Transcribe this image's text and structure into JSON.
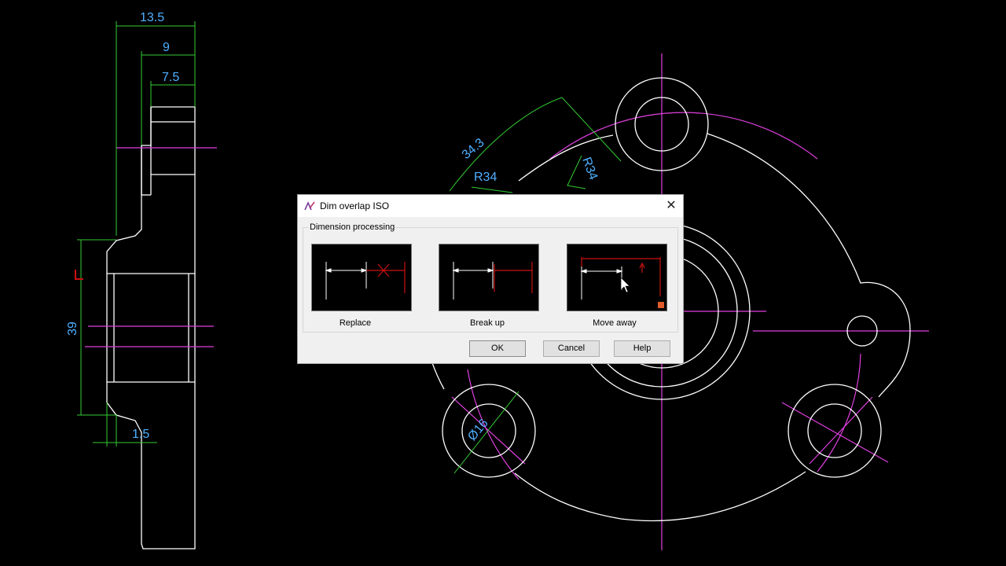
{
  "drawing": {
    "dimensions": {
      "width_overall": "13.5",
      "width_mid": "9",
      "width_inner": "7.5",
      "height_bore": "39",
      "step": "1.5",
      "arc_length": "34.3",
      "radius_left": "R34",
      "radius_right": "R34",
      "hole_diameter": "Ø16"
    }
  },
  "dialog": {
    "title": "Dim overlap ISO",
    "close_glyph": "✕",
    "group_label": "Dimension processing",
    "options": [
      {
        "label": "Replace"
      },
      {
        "label": "Break up"
      },
      {
        "label": "Move away"
      }
    ],
    "buttons": {
      "ok": "OK",
      "cancel": "Cancel",
      "help": "Help"
    }
  },
  "colors": {
    "background": "#000000",
    "geometry": "#ffffff",
    "centerline": "#e040e0",
    "dimension_line": "#33cc33",
    "dimension_text": "#4fb0ff",
    "highlight": "#cc1111"
  }
}
